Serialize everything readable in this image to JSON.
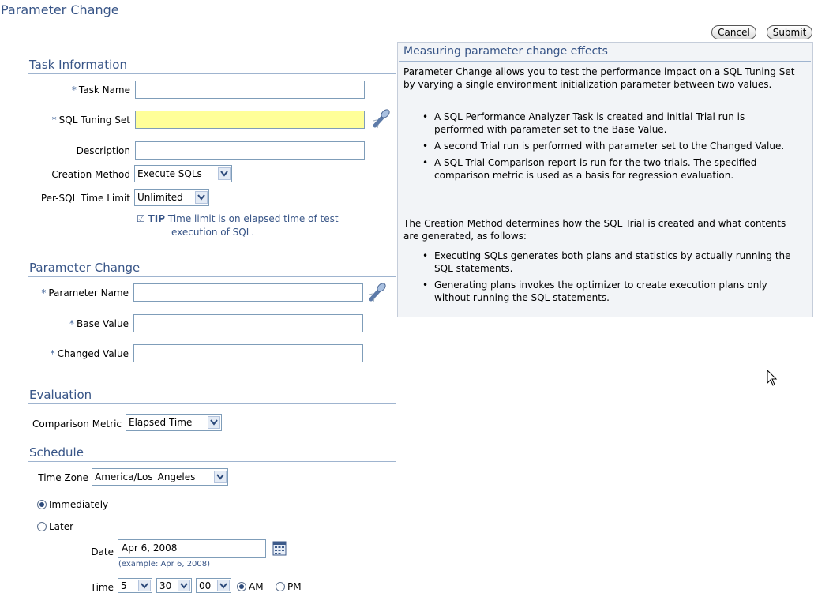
{
  "page": {
    "title": "Parameter Change"
  },
  "buttons": {
    "cancel": "Cancel",
    "submit": "Submit"
  },
  "task_info": {
    "header": "Task Information",
    "task_name": {
      "label": "Task Name",
      "value": ""
    },
    "sql_tuning_set": {
      "label": "SQL Tuning Set",
      "value": ""
    },
    "description": {
      "label": "Description",
      "value": ""
    },
    "creation_method": {
      "label": "Creation Method",
      "value": "Execute SQLs"
    },
    "time_limit": {
      "label": "Per-SQL Time Limit",
      "value": "Unlimited"
    },
    "tip_tag": "TIP",
    "tip_text": "Time limit is on elapsed time of test",
    "tip_text2": "execution of SQL."
  },
  "param_change": {
    "header": "Parameter Change",
    "parameter_name": {
      "label": "Parameter Name",
      "value": ""
    },
    "base_value": {
      "label": "Base Value",
      "value": ""
    },
    "changed_value": {
      "label": "Changed Value",
      "value": ""
    }
  },
  "evaluation": {
    "header": "Evaluation",
    "metric": {
      "label": "Comparison Metric",
      "value": "Elapsed Time"
    }
  },
  "schedule": {
    "header": "Schedule",
    "time_zone": {
      "label": "Time Zone",
      "value": "America/Los_Angeles"
    },
    "immediately": "Immediately",
    "later": "Later",
    "date": {
      "label": "Date",
      "value": "Apr 6, 2008",
      "hint": "(example: Apr 6, 2008)"
    },
    "time": {
      "label": "Time",
      "hour": "5",
      "minute": "30",
      "second": "00",
      "am": "AM",
      "pm": "PM"
    }
  },
  "help": {
    "title": "Measuring parameter change effects",
    "intro": "Parameter Change allows you to test the performance impact on a SQL Tuning Set by varying a single environment initialization parameter between two values.",
    "bullets1": [
      "A SQL Performance Analyzer Task is created and initial Trial run is performed with parameter set to the Base Value.",
      "A second Trial run is performed with parameter set to the Changed Value.",
      "A SQL Trial Comparison report is run for the two trials. The specified comparison metric is used as a basis for regression evaluation."
    ],
    "intro2": "The Creation Method determines how the SQL Trial is created and what contents are generated, as follows:",
    "bullets2": [
      "Executing SQLs generates both plans and statistics by actually running the SQL statements.",
      "Generating plans invokes the optimizer to create execution plans only without running the SQL statements."
    ]
  },
  "colors": {
    "accent": "#385587",
    "help_bg": "#f2f4f7",
    "highlight": "#ffff99"
  }
}
